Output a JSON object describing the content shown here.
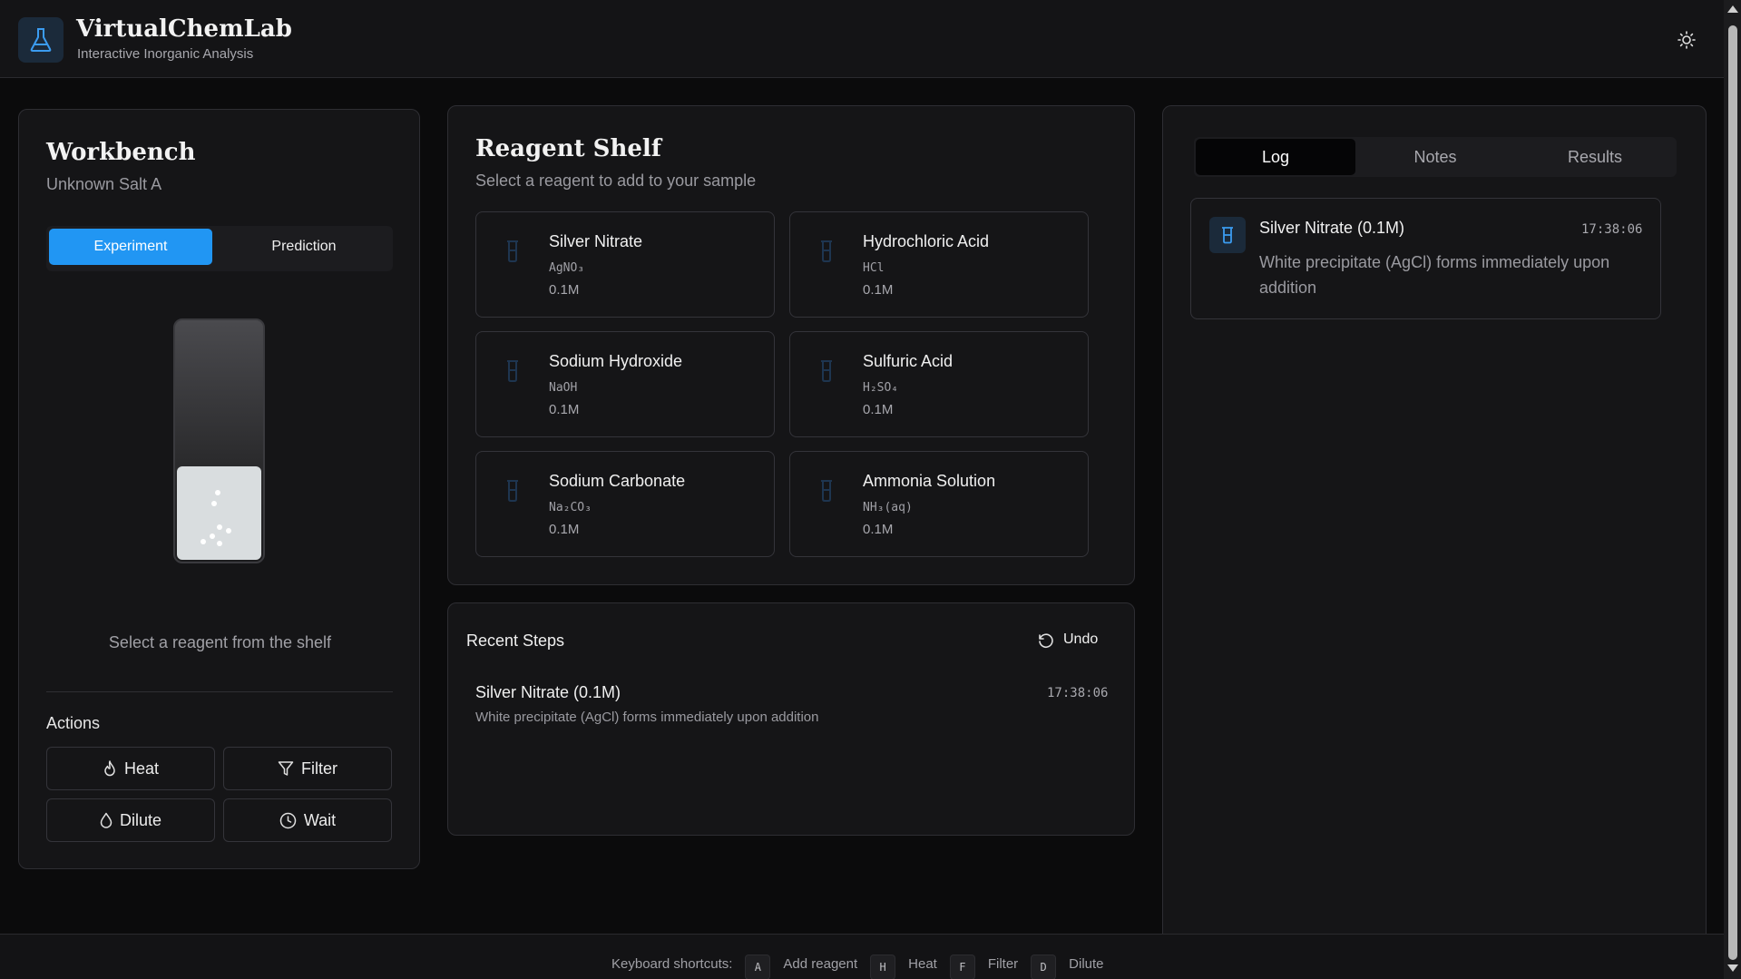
{
  "header": {
    "title": "VirtualChemLab",
    "subtitle": "Interactive Inorganic Analysis",
    "logo_icon": "flask-icon",
    "theme_icon": "sun-icon"
  },
  "workbench": {
    "title": "Workbench",
    "sample": "Unknown Salt A",
    "modes": [
      "Experiment",
      "Prediction"
    ],
    "active_mode": "Experiment",
    "hint": "Select a reagent from the shelf",
    "actions_label": "Actions",
    "actions": [
      {
        "label": "Heat",
        "icon": "flame-icon"
      },
      {
        "label": "Filter",
        "icon": "funnel-icon"
      },
      {
        "label": "Dilute",
        "icon": "droplet-icon"
      },
      {
        "label": "Wait",
        "icon": "clock-icon"
      }
    ]
  },
  "shelf": {
    "title": "Reagent Shelf",
    "subtitle": "Select a reagent to add to your sample",
    "reagents": [
      {
        "name": "Silver Nitrate",
        "formula": "AgNO₃",
        "conc": "0.1M"
      },
      {
        "name": "Hydrochloric Acid",
        "formula": "HCl",
        "conc": "0.1M"
      },
      {
        "name": "Sodium Hydroxide",
        "formula": "NaOH",
        "conc": "0.1M"
      },
      {
        "name": "Sulfuric Acid",
        "formula": "H₂SO₄",
        "conc": "0.1M"
      },
      {
        "name": "Sodium Carbonate",
        "formula": "Na₂CO₃",
        "conc": "0.1M"
      },
      {
        "name": "Ammonia Solution",
        "formula": "NH₃(aq)",
        "conc": "0.1M"
      }
    ]
  },
  "recent_steps": {
    "title": "Recent Steps",
    "undo_label": "Undo",
    "steps": [
      {
        "name": "Silver Nitrate (0.1M)",
        "time": "17:38:06",
        "desc": "White precipitate (AgCl) forms immediately upon addition"
      }
    ]
  },
  "log_panel": {
    "tabs": [
      "Log",
      "Notes",
      "Results"
    ],
    "active_tab": "Log",
    "entries": [
      {
        "name": "Silver Nitrate (0.1M)",
        "time": "17:38:06",
        "desc": "White precipitate (AgCl) forms immediately upon addition"
      }
    ]
  },
  "footer": {
    "label": "Keyboard shortcuts:",
    "shortcuts": [
      {
        "key": "A",
        "label": "Add reagent"
      },
      {
        "key": "H",
        "label": "Heat"
      },
      {
        "key": "F",
        "label": "Filter"
      },
      {
        "key": "D",
        "label": "Dilute"
      }
    ]
  },
  "colors": {
    "accent": "#2196f3",
    "background": "#0b0b0c",
    "panel": "#151517",
    "precipitate": "#d9dddf"
  }
}
